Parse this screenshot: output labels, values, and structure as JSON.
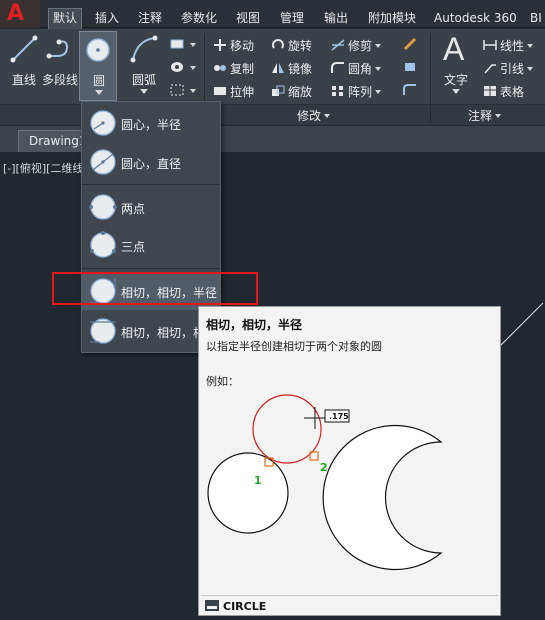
{
  "ribbon_tabs": [
    "默认",
    "插入",
    "注释",
    "参数化",
    "视图",
    "管理",
    "输出",
    "附加模块",
    "Autodesk 360",
    "BI"
  ],
  "app_button_letter": "A",
  "draw_panel": {
    "buttons": [
      {
        "label": "直线",
        "icon": "line-icon"
      },
      {
        "label": "多段线",
        "icon": "polyline-icon"
      },
      {
        "label": "圆",
        "icon": "circle-icon"
      },
      {
        "label": "圆弧",
        "icon": "arc-icon"
      }
    ]
  },
  "modify_panel": {
    "label": "修改",
    "rows": [
      [
        "移动",
        "旋转",
        "修剪"
      ],
      [
        "复制",
        "镜像",
        "圆角"
      ],
      [
        "拉伸",
        "缩放",
        "阵列"
      ]
    ]
  },
  "annotation_panel": {
    "label": "注释",
    "big_label": "文字",
    "big_glyph": "A",
    "items": [
      "线性",
      "引线",
      "表格"
    ]
  },
  "file_tab": "Drawing1",
  "view_controls": "[-][俯视][二维线",
  "circle_menu": {
    "items": [
      {
        "label": "圆心，半径"
      },
      {
        "label": "圆心，直径"
      },
      {
        "label": "两点"
      },
      {
        "label": "三点"
      },
      {
        "label": "相切，相切，半径"
      },
      {
        "label": "相切，相切，相"
      }
    ]
  },
  "tooltip": {
    "title": "相切，相切，半径",
    "description": "以指定半径创建相切于两个对象的圆",
    "example_label": "例如：",
    "figure": {
      "point_1": "1",
      "point_2": "2",
      "radius_value": ".175"
    },
    "command": "CIRCLE"
  },
  "colors": {
    "highlight_border": "#e5161e",
    "tangent_circle": "#d62020",
    "point_labels": "#22aa22"
  }
}
